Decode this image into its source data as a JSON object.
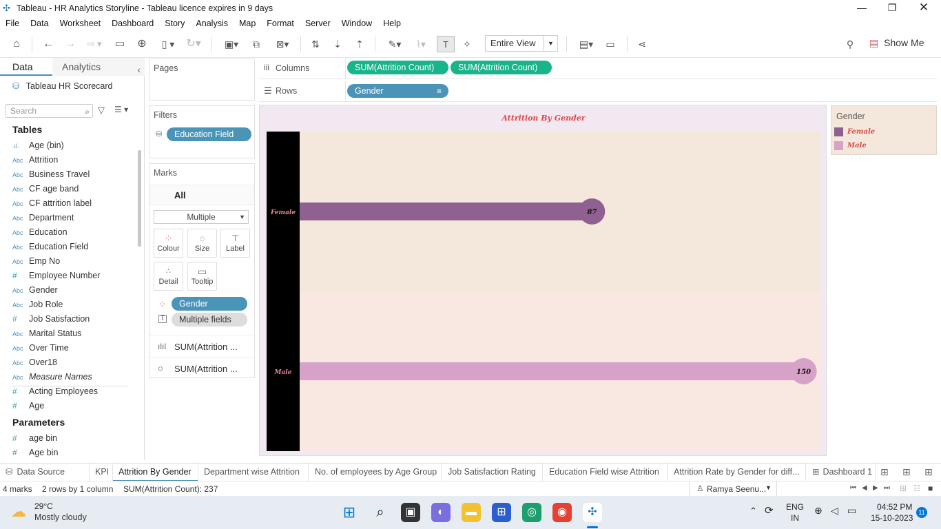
{
  "window": {
    "title": "Tableau - HR Analytics Storyline - Tableau licence expires in 9 days"
  },
  "menu": [
    "File",
    "Data",
    "Worksheet",
    "Dashboard",
    "Story",
    "Analysis",
    "Map",
    "Format",
    "Server",
    "Window",
    "Help"
  ],
  "toolbar": {
    "view_mode": "Entire View",
    "show_me": "Show Me"
  },
  "left_panel": {
    "tab_data": "Data",
    "tab_analytics": "Analytics",
    "datasource": "Tableau HR Scorecard",
    "search_placeholder": "Search",
    "tables_header": "Tables",
    "fields": [
      {
        "type": "bin",
        "name": "Age (bin)"
      },
      {
        "type": "Abc",
        "name": "Attrition"
      },
      {
        "type": "Abc",
        "name": "Business Travel"
      },
      {
        "type": "Abc",
        "name": "CF age band"
      },
      {
        "type": "Abc",
        "name": "CF attrition label"
      },
      {
        "type": "Abc",
        "name": "Department"
      },
      {
        "type": "Abc",
        "name": "Education"
      },
      {
        "type": "Abc",
        "name": "Education Field"
      },
      {
        "type": "Abc",
        "name": "Emp No"
      },
      {
        "type": "#",
        "name": "Employee Number"
      },
      {
        "type": "Abc",
        "name": "Gender"
      },
      {
        "type": "Abc",
        "name": "Job Role"
      },
      {
        "type": "#",
        "name": "Job Satisfaction"
      },
      {
        "type": "Abc",
        "name": "Marital Status"
      },
      {
        "type": "Abc",
        "name": "Over Time"
      },
      {
        "type": "Abc",
        "name": "Over18"
      },
      {
        "type": "Abc",
        "name": "Measure Names"
      },
      {
        "type": "#",
        "name": "Acting Employees"
      },
      {
        "type": "#",
        "name": "Age"
      }
    ],
    "parameters_header": "Parameters",
    "parameters": [
      {
        "type": "#",
        "name": "age bin"
      },
      {
        "type": "#",
        "name": "Age bin"
      }
    ]
  },
  "shelves": {
    "pages": "Pages",
    "filters": "Filters",
    "filter_pill": "Education Field",
    "marks": "Marks",
    "marks_all": "All",
    "mark_type": "Multiple",
    "mark_buttons": [
      "Colour",
      "Size",
      "Label",
      "Detail",
      "Tooltip"
    ],
    "mark_pills": [
      "Gender",
      "Multiple fields"
    ],
    "measure_cards": [
      "SUM(Attrition ...",
      "SUM(Attrition ..."
    ],
    "columns_label": "Columns",
    "columns_pills": [
      "SUM(Attrition Count)",
      "SUM(Attrition Count)"
    ],
    "rows_label": "Rows",
    "rows_pill": "Gender"
  },
  "colors": {
    "female": "#8e6191",
    "male": "#d6a2c8",
    "title": "#e04848",
    "female_band": "#f4e7db",
    "male_band": "#f9e7e2"
  },
  "chart_data": {
    "type": "bar",
    "title": "Attrition By Gender",
    "categories": [
      "Female",
      "Male"
    ],
    "values": [
      87,
      150
    ],
    "labels": [
      "87",
      "150"
    ],
    "xlim": [
      0,
      155
    ]
  },
  "legend": {
    "title": "Gender",
    "items": [
      "Female",
      "Male"
    ]
  },
  "sheet_tabs": [
    "Data Source",
    "KPI",
    "Attrition By Gender",
    "Department wise Attrition",
    "No. of employees by Age Group",
    "Job Satisfaction Rating",
    "Education Field wise Attrition",
    "Attrition Rate by Gender for diff...",
    "Dashboard 1"
  ],
  "status": {
    "marks": "4 marks",
    "rows_cols": "2 rows  by  1 column",
    "sum": "SUM(Attrition Count): 237",
    "user": "Ramya Seenu..."
  },
  "taskbar": {
    "temp": "29°C",
    "weather": "Mostly cloudy",
    "lang1": "ENG",
    "lang2": "IN",
    "time": "04:52 PM",
    "date": "15-10-2023",
    "notif": "11"
  }
}
